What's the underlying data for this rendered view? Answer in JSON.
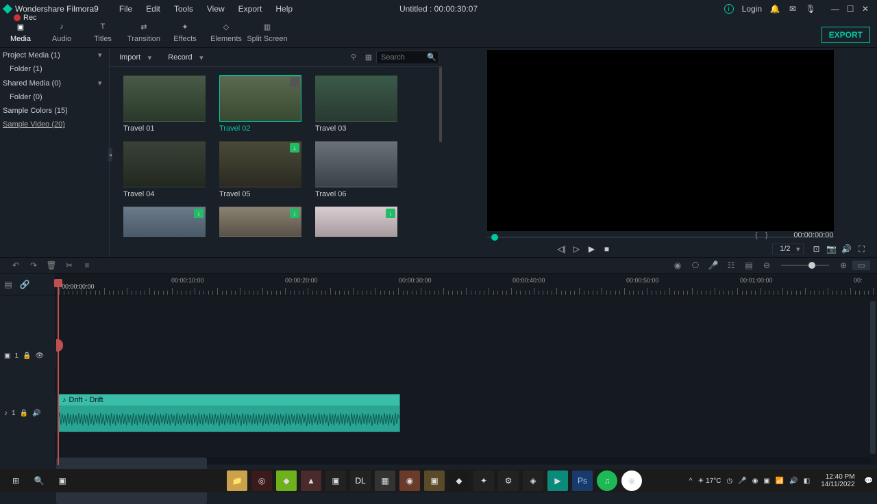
{
  "app": {
    "name": "Wondershare Filmora9",
    "title_center": "Untitled : 00:00:30:07",
    "login": "Login",
    "rec": "Rec"
  },
  "menu": {
    "file": "File",
    "edit": "Edit",
    "tools": "Tools",
    "view": "View",
    "export": "Export",
    "help": "Help"
  },
  "tabs": {
    "media": "Media",
    "audio": "Audio",
    "titles": "Titles",
    "transition": "Transition",
    "effects": "Effects",
    "elements": "Elements",
    "split": "Split Screen",
    "export_btn": "EXPORT"
  },
  "sidebar": {
    "project_media": "Project Media (1)",
    "folder1": "Folder (1)",
    "shared_media": "Shared Media (0)",
    "folder0": "Folder (0)",
    "sample_colors": "Sample Colors (15)",
    "sample_video": "Sample Video (20)"
  },
  "browser_bar": {
    "import": "Import",
    "record": "Record",
    "search_ph": "Search"
  },
  "clips": {
    "t1": "Travel 01",
    "t2": "Travel 02",
    "t3": "Travel 03",
    "t4": "Travel 04",
    "t5": "Travel 05",
    "t6": "Travel 06"
  },
  "preview": {
    "timecode": "00:00:00:00",
    "zoom": "1/2"
  },
  "timeline": {
    "playhead_tc": "00:00:00:00",
    "ruler": [
      "00:00:10:00",
      "00:00:20:00",
      "00:00:30:00",
      "00:00:40:00",
      "00:00:50:00",
      "00:01:00:00",
      "00:"
    ],
    "video_track": "1",
    "audio_track": "1",
    "audio_clip": "Drift - Drift"
  },
  "taskbar": {
    "weather": "17°C",
    "time": "12:40 PM",
    "date": "14/11/2022"
  }
}
